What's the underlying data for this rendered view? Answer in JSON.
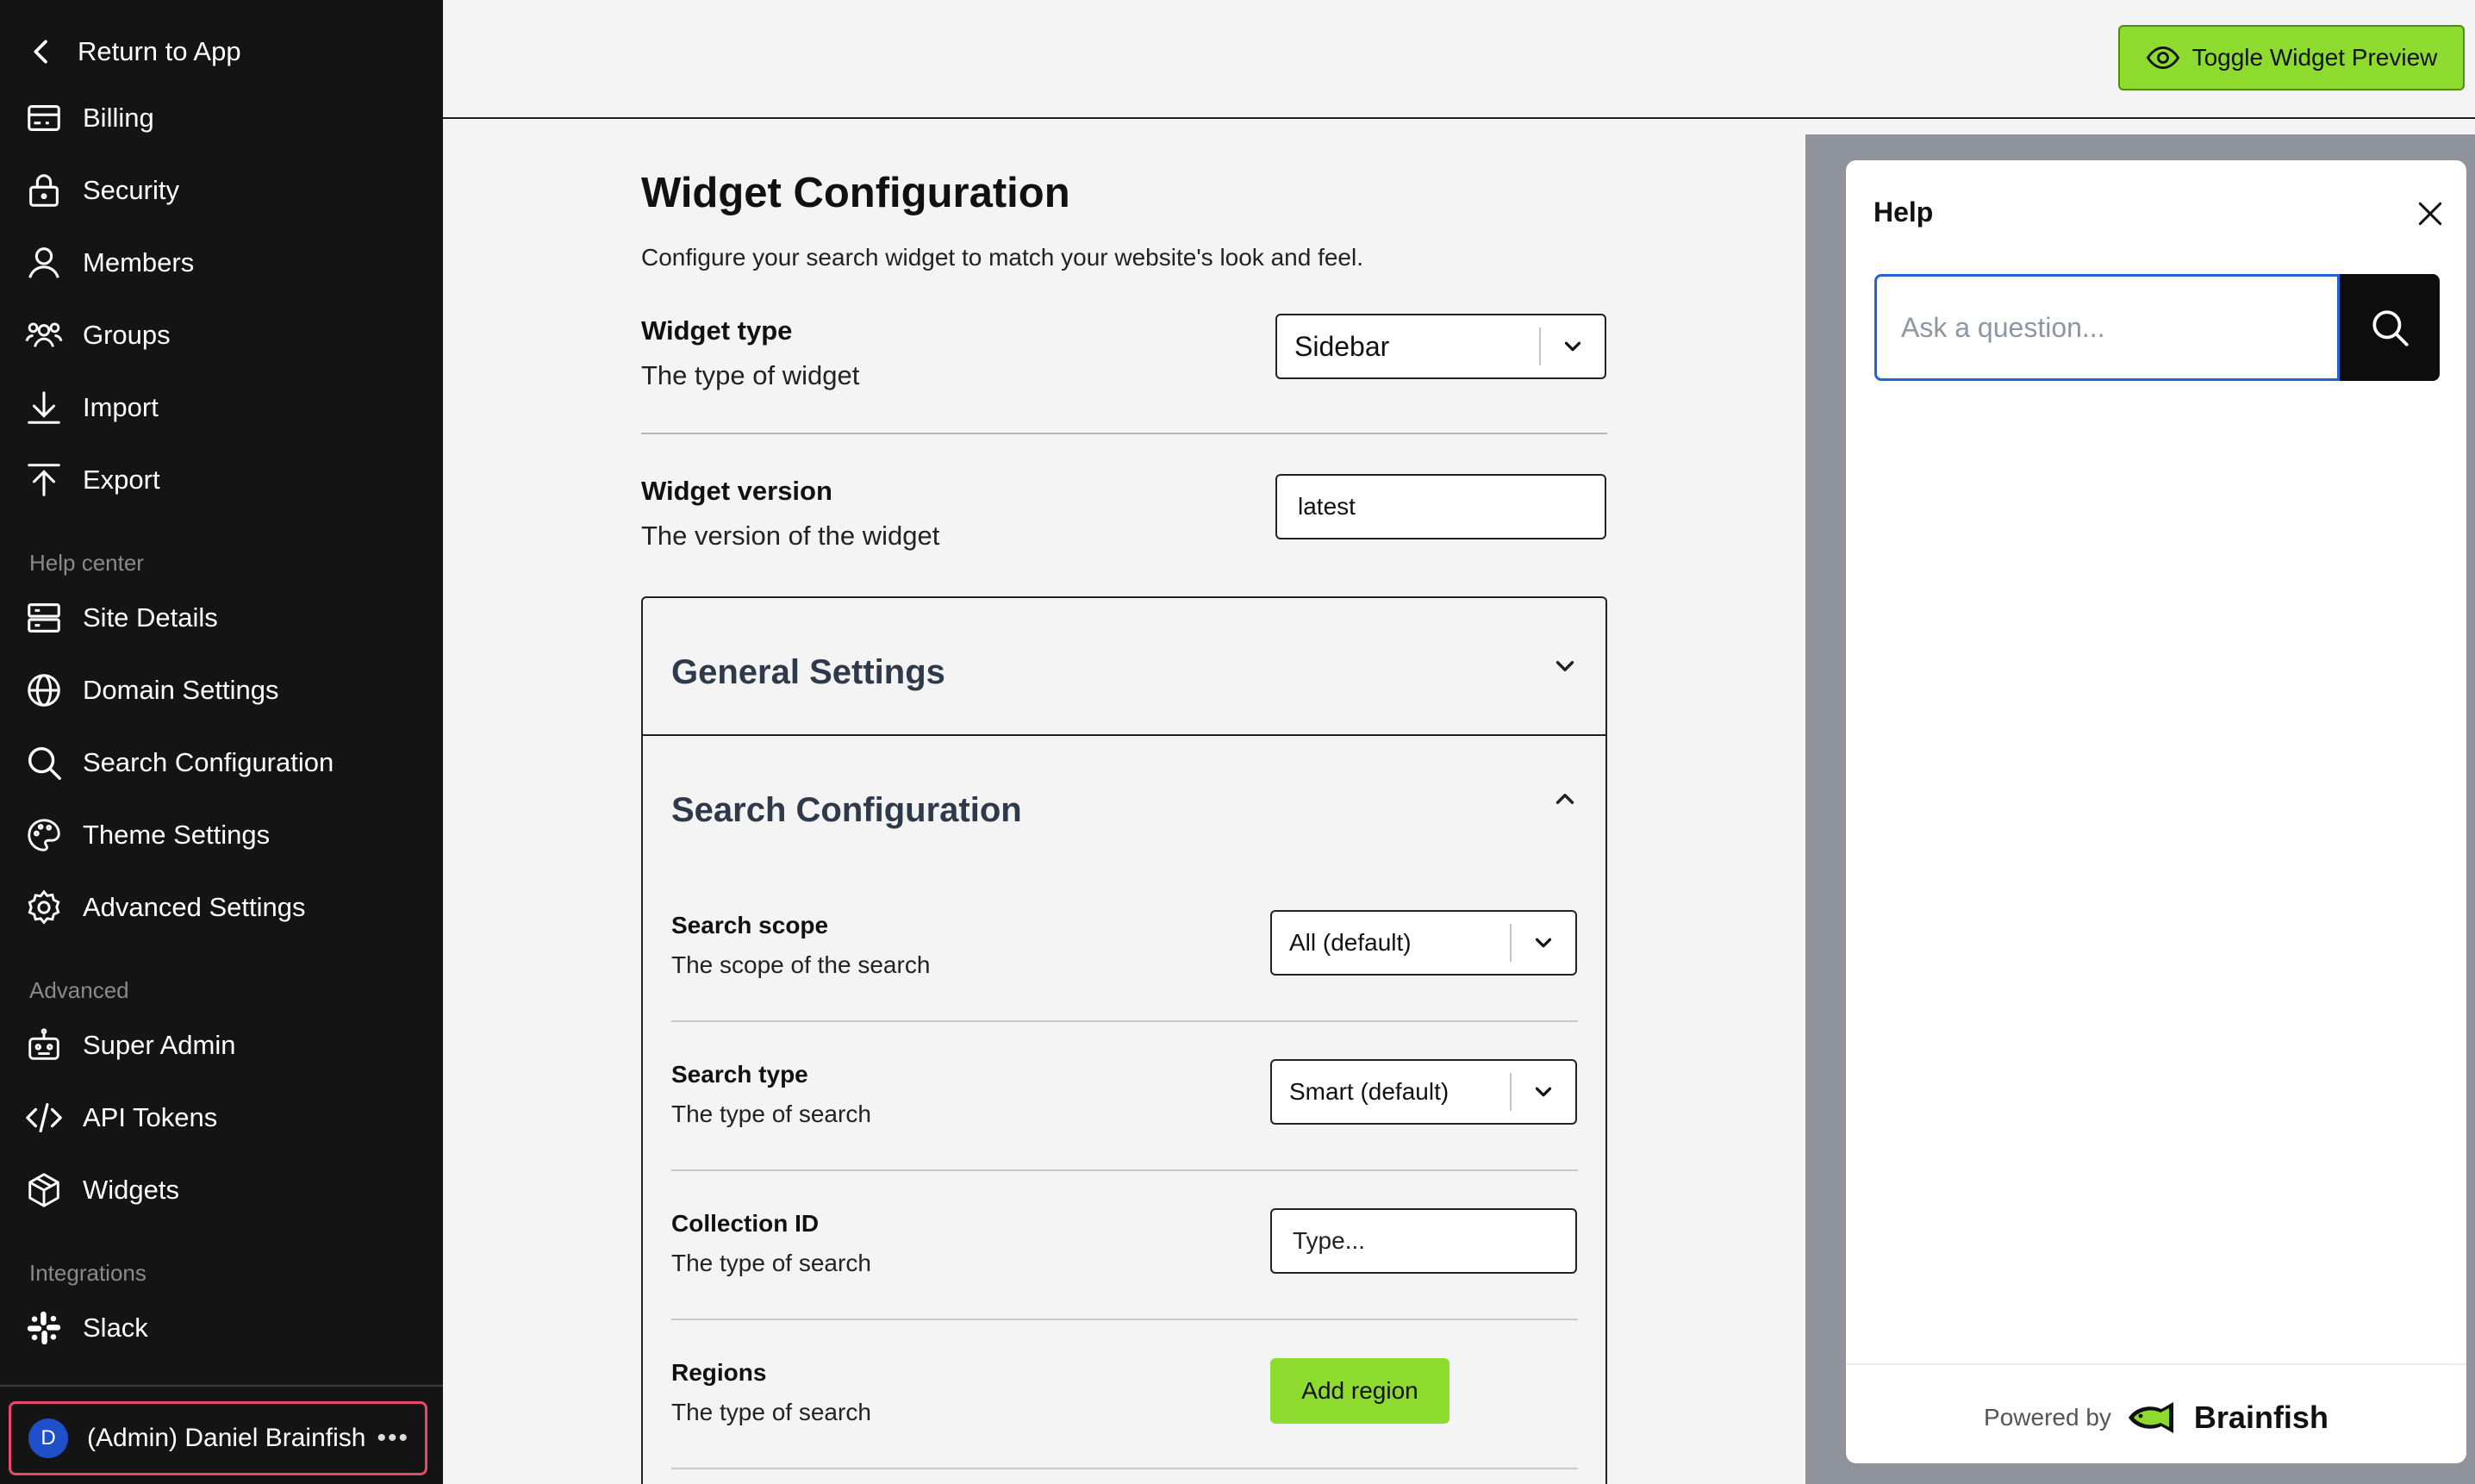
{
  "sidebar": {
    "return_label": "Return to App",
    "items_top": [
      {
        "label": "Billing",
        "icon": "billing-icon"
      },
      {
        "label": "Security",
        "icon": "lock-icon"
      },
      {
        "label": "Members",
        "icon": "user-icon"
      },
      {
        "label": "Groups",
        "icon": "users-group-icon"
      },
      {
        "label": "Import",
        "icon": "download-icon"
      },
      {
        "label": "Export",
        "icon": "upload-icon"
      }
    ],
    "section_help_center": "Help center",
    "items_help_center": [
      {
        "label": "Site Details",
        "icon": "server-icon"
      },
      {
        "label": "Domain Settings",
        "icon": "globe-icon"
      },
      {
        "label": "Search Configuration",
        "icon": "search-icon"
      },
      {
        "label": "Theme Settings",
        "icon": "palette-icon"
      },
      {
        "label": "Advanced Settings",
        "icon": "gear-icon"
      }
    ],
    "section_advanced": "Advanced",
    "items_advanced": [
      {
        "label": "Super Admin",
        "icon": "robot-icon"
      },
      {
        "label": "API Tokens",
        "icon": "code-icon"
      },
      {
        "label": "Widgets",
        "icon": "cube-icon"
      }
    ],
    "section_integrations": "Integrations",
    "items_integrations": [
      {
        "label": "Slack",
        "icon": "slack-icon"
      }
    ],
    "user": {
      "initial": "D",
      "name": "(Admin) Daniel Brainfish",
      "more": "•••"
    }
  },
  "topbar": {
    "toggle_label": "Toggle Widget Preview",
    "toggle_icon": "eye-icon"
  },
  "main": {
    "title": "Widget Configuration",
    "subtitle": "Configure your search widget to match your website's look and feel.",
    "widget_type": {
      "label": "Widget type",
      "desc": "The type of widget",
      "value": "Sidebar"
    },
    "widget_version": {
      "label": "Widget version",
      "desc": "The version of the widget",
      "value": "latest"
    },
    "general_settings": {
      "title": "General Settings",
      "expanded": false
    },
    "search_configuration": {
      "title": "Search Configuration",
      "expanded": true,
      "search_scope": {
        "label": "Search scope",
        "desc": "The scope of the search",
        "value": "All (default)"
      },
      "search_type": {
        "label": "Search type",
        "desc": "The type of search",
        "value": "Smart (default)"
      },
      "collection_id": {
        "label": "Collection ID",
        "desc": "The type of search",
        "placeholder": "Type..."
      },
      "regions": {
        "label": "Regions",
        "desc": "The type of search",
        "button": "Add region"
      }
    }
  },
  "preview": {
    "title": "Help",
    "placeholder": "Ask a question...",
    "powered_by": "Powered by",
    "brand": "Brainfish"
  },
  "colors": {
    "sidebar_bg": "#141414",
    "accent_green": "#8edb2f",
    "user_card_border": "#e8486b",
    "avatar_bg": "#1f4fc9",
    "input_focus": "#2463d6"
  }
}
